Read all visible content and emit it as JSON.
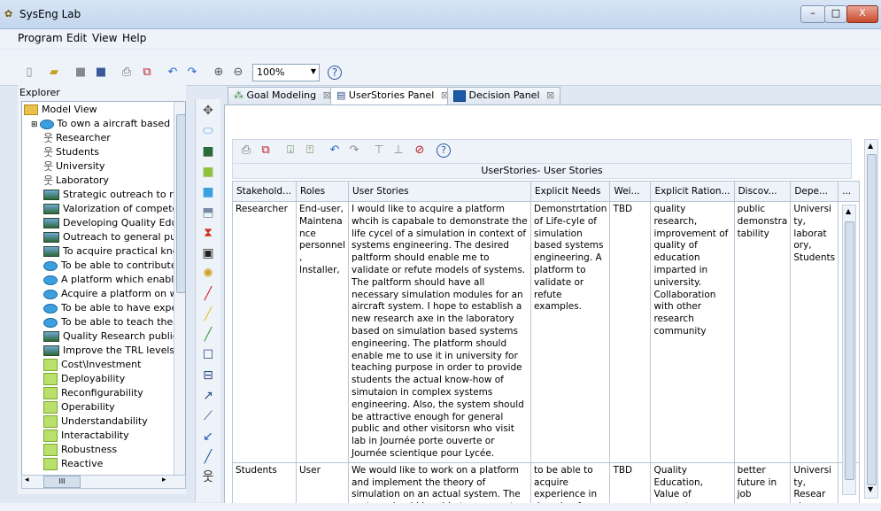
{
  "window": {
    "title": "SysEng Lab",
    "app_icon": "yellow-logo-icon",
    "buttons": [
      "–",
      "□",
      "X"
    ]
  },
  "menu": [
    "Program",
    "Edit",
    "View",
    "Help"
  ],
  "toolbar": {
    "icons": [
      "new-file-icon",
      "open-folder-icon",
      "save-disabled-icon",
      "save-icon",
      "print-icon",
      "pdf-icon",
      "undo-icon",
      "redo-icon",
      "zoom-in-icon",
      "zoom-out-icon"
    ],
    "zoom": "100%",
    "help_icon": "help-icon"
  },
  "explorer": {
    "title": "Explorer",
    "items": [
      {
        "label": "Model View",
        "icon": "folder",
        "indent": 0
      },
      {
        "label": "To own a aircraft based p",
        "icon": "ellipse",
        "indent": 1
      },
      {
        "label": "Researcher",
        "icon": "actor",
        "indent": 2
      },
      {
        "label": "Students",
        "icon": "actor",
        "indent": 2
      },
      {
        "label": "University",
        "icon": "actor",
        "indent": 2
      },
      {
        "label": "Laboratory",
        "icon": "actor",
        "indent": 2
      },
      {
        "label": "Strategic outreach to rese",
        "icon": "goal",
        "indent": 2
      },
      {
        "label": "Valorization of competenc",
        "icon": "goal",
        "indent": 2
      },
      {
        "label": "Developing Quality Educa",
        "icon": "goal",
        "indent": 2
      },
      {
        "label": "Outreach to general publi",
        "icon": "goal",
        "indent": 2
      },
      {
        "label": "To acquire practical knowl",
        "icon": "goal",
        "indent": 2
      },
      {
        "label": "To be able to contribute ir",
        "icon": "ellipse",
        "indent": 2
      },
      {
        "label": "A platform which enables",
        "icon": "ellipse",
        "indent": 2
      },
      {
        "label": "Acquire a platform on whi",
        "icon": "ellipse",
        "indent": 2
      },
      {
        "label": "To be able to have experi",
        "icon": "ellipse",
        "indent": 2
      },
      {
        "label": "To be able to teach theor",
        "icon": "ellipse",
        "indent": 2
      },
      {
        "label": "Quality Research publicat",
        "icon": "goal",
        "indent": 2
      },
      {
        "label": "Improve the TRL levels to",
        "icon": "goal",
        "indent": 2
      },
      {
        "label": "Cost\\Investment",
        "icon": "soft",
        "indent": 2
      },
      {
        "label": "Deployability",
        "icon": "soft",
        "indent": 2
      },
      {
        "label": "Reconfigurability",
        "icon": "soft",
        "indent": 2
      },
      {
        "label": "Operability",
        "icon": "soft",
        "indent": 2
      },
      {
        "label": "Understandability",
        "icon": "soft",
        "indent": 2
      },
      {
        "label": "Interactability",
        "icon": "soft",
        "indent": 2
      },
      {
        "label": "Robustness",
        "icon": "soft",
        "indent": 2
      },
      {
        "label": "Reactive",
        "icon": "soft",
        "indent": 2
      }
    ],
    "hscroll_label": "III"
  },
  "palette": [
    "move-icon",
    "ellipse-icon",
    "goal-icon",
    "softgoal-icon",
    "rectangle-icon",
    "package-icon",
    "resource-icon",
    "task-icon",
    "cloud-icon",
    "red-line-icon",
    "yellow-line-icon",
    "green-line-icon",
    "box-icon",
    "split-box-icon",
    "arrow-icon",
    "dependency-icon",
    "blue-arrow-icon",
    "line-icon",
    "actor-icon"
  ],
  "tabs": [
    {
      "label": "Goal Modeling",
      "icon": "goal-model-icon",
      "active": false
    },
    {
      "label": "UserStories Panel",
      "icon": "list-icon",
      "active": true
    },
    {
      "label": "Decision Panel",
      "icon": "decision-icon",
      "active": false
    }
  ],
  "inner_toolbar": [
    "print-icon",
    "pdf-icon",
    "export-icon",
    "import-icon",
    "undo-icon",
    "redo-icon",
    "add-column-icon",
    "remove-column-icon",
    "delete-icon",
    "help-icon"
  ],
  "table": {
    "caption": "UserStories- User Stories",
    "headers": [
      "Stakehold...",
      "Roles",
      "User Stories",
      "Explicit Needs",
      "Wei...",
      "Explicit Ration...",
      "Discov...",
      "Depe...",
      "..."
    ],
    "rows": [
      {
        "stakeholder": "Researcher",
        "roles": "End-user, Maintena nce personnel , Installer,",
        "story": "I would like to acquire a platform whcih is capabale to demonstrate the life cycel of a simulation in context of systems engineering. The desired paltform should enable me to validate or refute models of systems. The paltform should have all necessary simulation modules for an aircraft system. I hope to establish a new research axe in the laboratory based on simulation based systems engineering. The platform should enable me to use it in university for teaching purpose in order to provide students the actual know-how of simutaion in complex systems engineering. Also, the system should be attractive enough for general public and other visitorsn who visit lab in Journée porte ouverte or Journée scientique pour Lycée.",
        "needs": "Demonstrtation of Life-cyle of simulation based systems engineering. A platform to validate or refute examples.",
        "weight": "TBD",
        "rationale": "quality research, improvement of quality of education imparted in university. Collaboration with other research community",
        "discovered": "public demonstra tability",
        "depends": "Universi ty, laborat ory, Students",
        "more": ""
      },
      {
        "stakeholder": "Students",
        "roles": "User",
        "story": "We would like to work on a platform and implement the theory of simulation on an actual system. The system should be able to carry out praticals and should be",
        "needs": "to be able to acquire experience in domain of",
        "weight": "TBD",
        "rationale": "Quality Education, Value of competences",
        "discovered": "better future in job",
        "depends": "Universi ty, Resear cher,",
        "more": ""
      }
    ]
  }
}
